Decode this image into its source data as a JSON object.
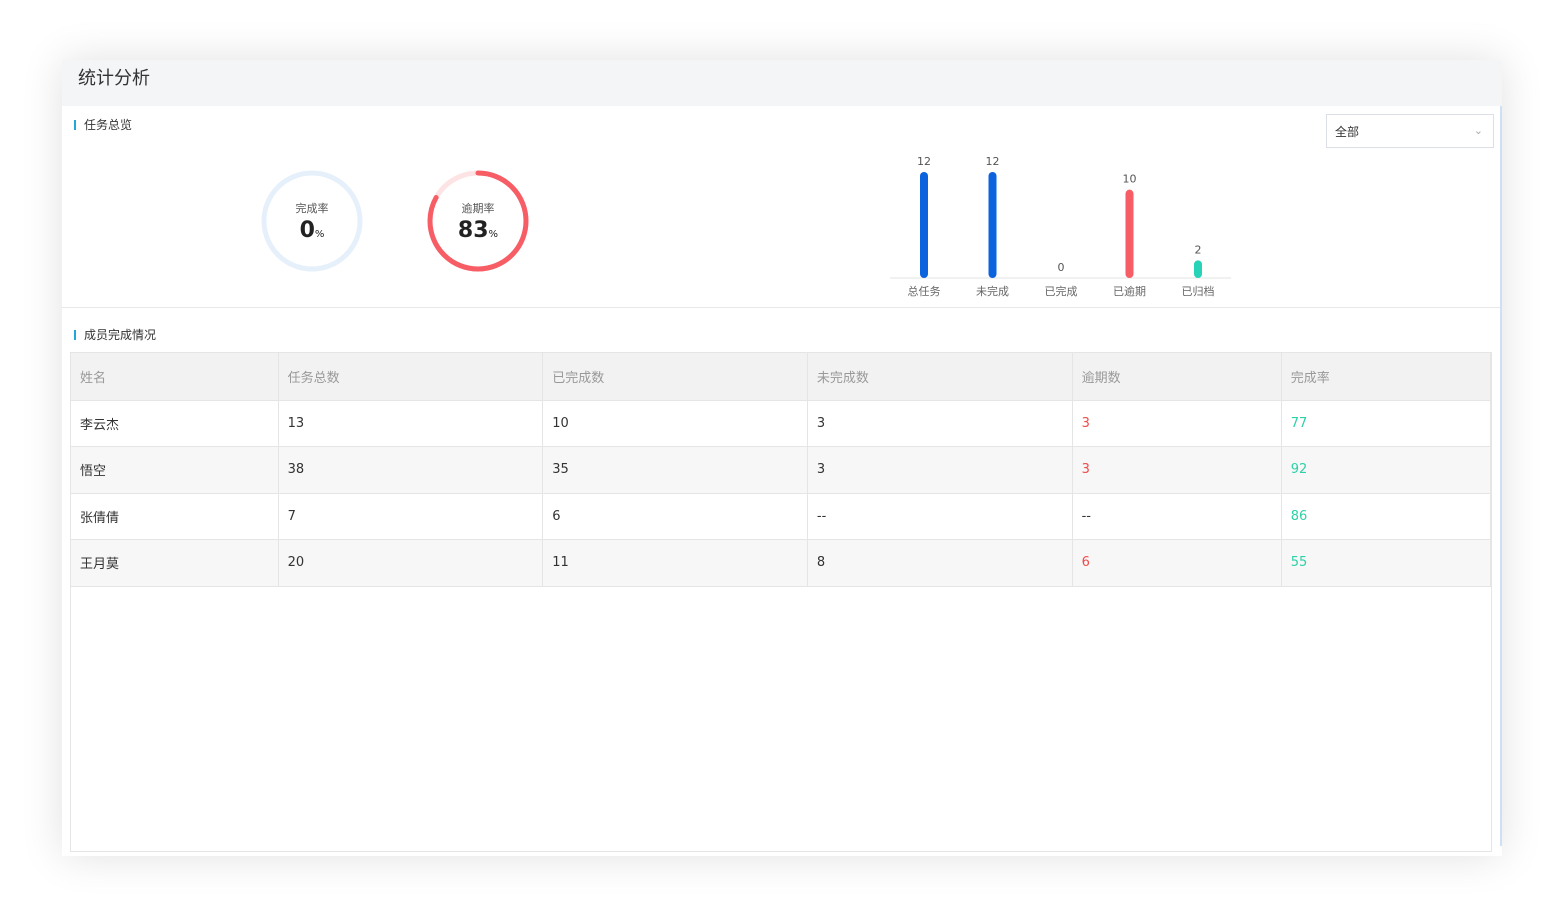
{
  "page_title": "统计分析",
  "overview": {
    "section_title": "任务总览",
    "filter": {
      "selected": "全部"
    },
    "completion": {
      "label": "完成率",
      "value": "0",
      "unit": "%",
      "fraction": 0.0,
      "color": "#e6f0fb"
    },
    "overdue": {
      "label": "逾期率",
      "value": "83",
      "unit": "%",
      "fraction": 0.83,
      "color": "#f65d65"
    }
  },
  "chart_data": {
    "type": "bar",
    "categories": [
      "总任务",
      "未完成",
      "已完成",
      "已逾期",
      "已归档"
    ],
    "values": [
      12,
      12,
      0,
      10,
      2
    ],
    "colors": [
      "#0b63de",
      "#0b63de",
      "#0b63de",
      "#f65d65",
      "#27d3b8"
    ],
    "ylim": [
      0,
      12
    ]
  },
  "members": {
    "section_title": "成员完成情况",
    "columns": [
      "姓名",
      "任务总数",
      "已完成数",
      "未完成数",
      "逾期数",
      "完成率"
    ],
    "rows": [
      [
        "李云杰",
        "13",
        "10",
        "3",
        "3",
        "77"
      ],
      [
        "悟空",
        "38",
        "35",
        "3",
        "3",
        "92"
      ],
      [
        "张倩倩",
        "7",
        "6",
        "--",
        "--",
        "86"
      ],
      [
        "王月莫",
        "20",
        "11",
        "8",
        "6",
        "55"
      ]
    ]
  }
}
